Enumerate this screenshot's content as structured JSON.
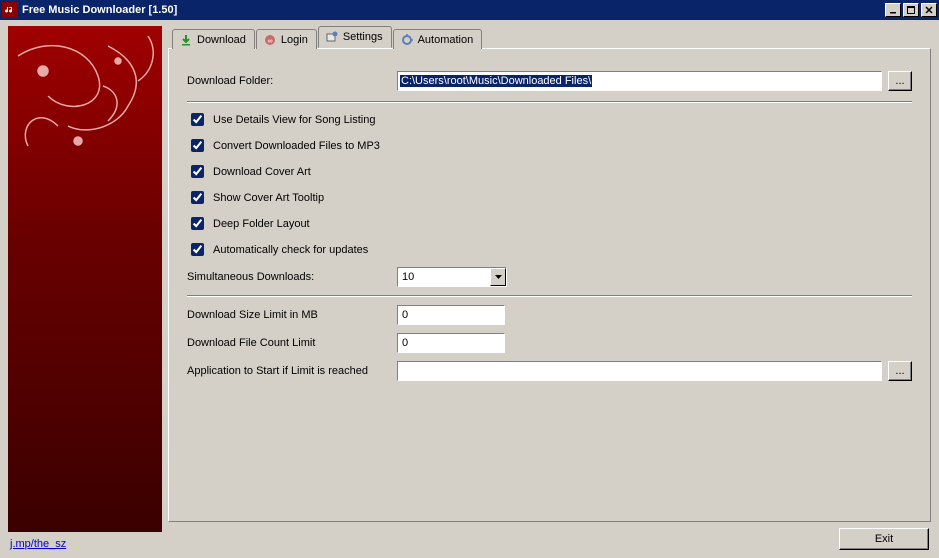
{
  "window": {
    "title": "Free Music Downloader [1.50]"
  },
  "tabs": {
    "download": "Download",
    "login": "Login",
    "settings": "Settings",
    "automation": "Automation"
  },
  "settings": {
    "download_folder_label": "Download Folder:",
    "download_folder_value": "C:\\Users\\root\\Music\\Downloaded Files\\",
    "browse_button": "...",
    "checks": {
      "details_view": "Use Details View for Song Listing",
      "convert_mp3": "Convert Downloaded Files to MP3",
      "cover_art": "Download Cover Art",
      "cover_tooltip": "Show Cover Art Tooltip",
      "deep_folder": "Deep Folder Layout",
      "auto_update": "Automatically check for updates"
    },
    "simul_label": "Simultaneous Downloads:",
    "simul_value": "10",
    "size_limit_label": "Download Size Limit in MB",
    "size_limit_value": "0",
    "count_limit_label": "Download File Count Limit",
    "count_limit_value": "0",
    "app_start_label": "Application to Start if Limit is reached",
    "app_start_value": "",
    "app_browse": "..."
  },
  "footer": {
    "link": "j.mp/the_sz",
    "exit": "Exit"
  }
}
